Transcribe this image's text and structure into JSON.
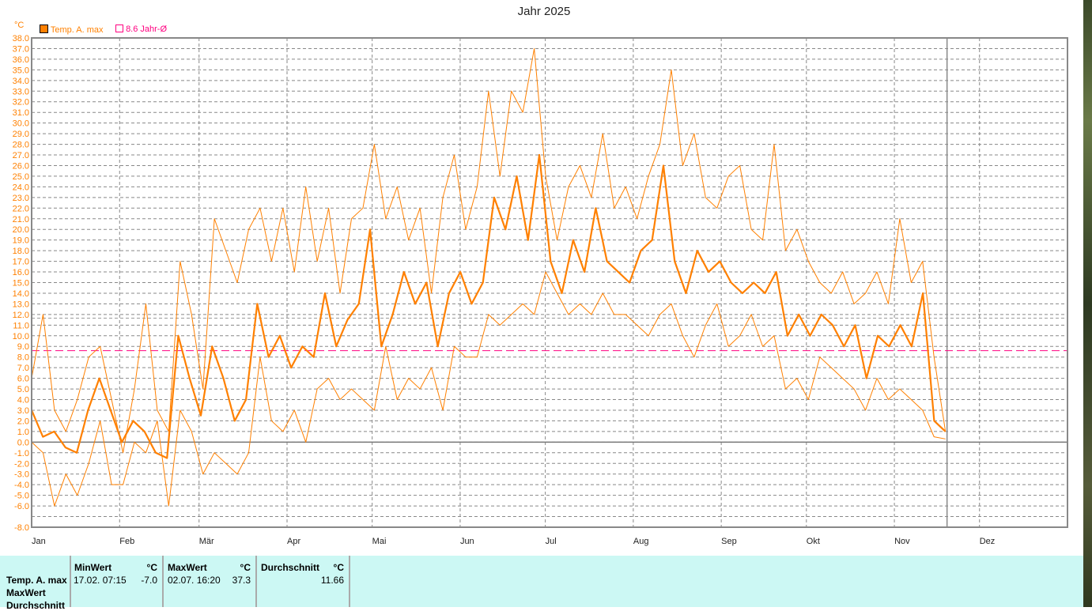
{
  "title": "Jahr 2025",
  "unit": "°C",
  "legend": [
    {
      "label": "Temp. A. max",
      "color": "#ff8000"
    },
    {
      "label": "8.6 Jahr-Ø",
      "color": "#ff0080"
    }
  ],
  "chart_data": {
    "type": "line",
    "title": "Jahr 2025",
    "ylabel": "°C",
    "ylim": [
      -8,
      38
    ],
    "y_tick_step": 1,
    "x_ticks": [
      "Jan",
      "Feb",
      "Mär",
      "Apr",
      "Mai",
      "Jun",
      "Jul",
      "Aug",
      "Sep",
      "Okt",
      "Nov",
      "Dez"
    ],
    "x_tick_days": [
      0,
      31,
      59,
      90,
      120,
      151,
      181,
      212,
      243,
      273,
      304,
      334
    ],
    "days_in_year": 365,
    "data_last_day": 322,
    "current_day_marker": 322,
    "reference_lines": [
      {
        "name": "8.6 Jahr-Ø",
        "value": 8.6,
        "color": "#ff0080"
      },
      {
        "name": "Durchschnitt",
        "value": 11.66,
        "color": "#999999"
      }
    ],
    "series": [
      {
        "name": "Temp. A. max (high)",
        "width": 1,
        "values": [
          6,
          12,
          3,
          1,
          4,
          8,
          9,
          4,
          -1,
          5,
          13,
          3,
          1,
          17,
          12,
          5,
          21,
          18,
          15,
          20,
          22,
          17,
          22,
          16,
          24,
          17,
          22,
          14,
          21,
          22,
          28,
          21,
          24,
          19,
          22,
          14,
          23,
          27,
          20,
          24,
          33,
          25,
          33,
          31,
          37,
          25,
          19,
          24,
          26,
          23,
          29,
          22,
          24,
          21,
          25,
          28,
          35,
          26,
          29,
          23,
          22,
          25,
          26,
          20,
          19,
          28,
          18,
          20,
          17,
          15,
          14,
          16,
          13,
          14,
          16,
          13,
          21,
          15,
          17,
          8,
          1
        ]
      },
      {
        "name": "Temp. A. max",
        "width": 2.2,
        "values": [
          3,
          0.5,
          1,
          -0.5,
          -1,
          3,
          6,
          3,
          0,
          2,
          1,
          -1,
          -1.5,
          10,
          6,
          2.5,
          9,
          6,
          2,
          4,
          13,
          8,
          10,
          7,
          9,
          8,
          14,
          9,
          11.5,
          13,
          20,
          9,
          12,
          16,
          13,
          15,
          9,
          14,
          16,
          13,
          15,
          23,
          20,
          25,
          19,
          27,
          17,
          14,
          19,
          16,
          22,
          17,
          16,
          15,
          18,
          19,
          26,
          17,
          14,
          18,
          16,
          17,
          15,
          14,
          15,
          14,
          16,
          10,
          12,
          10,
          12,
          11,
          9,
          11,
          6,
          10,
          9,
          11,
          9,
          14,
          2,
          1
        ]
      },
      {
        "name": "Temp. A. max (low)",
        "width": 1,
        "values": [
          0,
          -1,
          -6,
          -3,
          -5,
          -2,
          2,
          -4,
          -4,
          0,
          -1,
          2,
          -6,
          3,
          1,
          -3,
          -1,
          -2,
          -3,
          -1,
          8,
          2,
          1,
          3,
          0,
          5,
          6,
          4,
          5,
          4,
          3,
          9,
          4,
          6,
          5,
          7,
          3,
          9,
          8,
          8,
          12,
          11,
          12,
          13,
          12,
          16,
          14,
          12,
          13,
          12,
          14,
          12,
          12,
          11,
          10,
          12,
          13,
          10,
          8,
          11,
          13,
          9,
          10,
          12,
          9,
          10,
          5,
          6,
          4,
          8,
          7,
          6,
          5,
          3,
          6,
          4,
          5,
          4,
          3,
          0.5,
          0.3
        ]
      }
    ]
  },
  "table": {
    "row_labels": [
      "Temp. A. max",
      "MaxWert",
      "Durchschnitt"
    ],
    "min": {
      "header": "MinWert",
      "unit": "°C",
      "date": "17.02.  07:15",
      "value": "-7.0"
    },
    "max": {
      "header": "MaxWert",
      "unit": "°C",
      "date": "02.07.  16:20",
      "value": "37.3"
    },
    "avg": {
      "header": "Durchschnitt",
      "unit": "°C",
      "value": "11.66"
    }
  }
}
